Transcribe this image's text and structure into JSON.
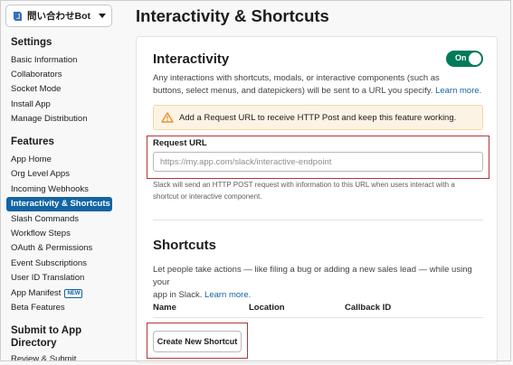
{
  "app": {
    "name": "問い合わせBot"
  },
  "sidebar": {
    "settings_heading": "Settings",
    "settings_items": [
      {
        "label": "Basic Information"
      },
      {
        "label": "Collaborators"
      },
      {
        "label": "Socket Mode"
      },
      {
        "label": "Install App"
      },
      {
        "label": "Manage Distribution"
      }
    ],
    "features_heading": "Features",
    "features_items": [
      {
        "label": "App Home"
      },
      {
        "label": "Org Level Apps"
      },
      {
        "label": "Incoming Webhooks"
      },
      {
        "label": "Interactivity & Shortcuts",
        "active": true
      },
      {
        "label": "Slash Commands"
      },
      {
        "label": "Workflow Steps"
      },
      {
        "label": "OAuth & Permissions"
      },
      {
        "label": "Event Subscriptions"
      },
      {
        "label": "User ID Translation"
      },
      {
        "label": "App Manifest",
        "badge": "NEW"
      },
      {
        "label": "Beta Features"
      }
    ],
    "submit_heading_line1": "Submit to App",
    "submit_heading_line2": "Directory",
    "submit_items": [
      {
        "label": "Review & Submit"
      }
    ]
  },
  "page": {
    "title": "Interactivity & Shortcuts"
  },
  "interactivity": {
    "title": "Interactivity",
    "toggle_label": "On",
    "toggle_state": "on",
    "description_line1": "Any interactions with shortcuts, modals, or interactive components (such as",
    "description_line2": "buttons, select menus, and datepickers) will be sent to a URL you specify.",
    "learn_more": "Learn more.",
    "warning": "Add a Request URL to receive HTTP Post and keep this feature working.",
    "request_url_label": "Request URL",
    "request_url_value": "",
    "request_url_placeholder": "https://my.app.com/slack/interactive-endpoint",
    "help_line1": "Slack will send an HTTP POST request with information to this URL when users interact with a",
    "help_line2": "shortcut or interactive component."
  },
  "shortcuts": {
    "title": "Shortcuts",
    "description_line1": "Let people take actions — like filing a bug or adding a new sales lead — while using your",
    "description_line2": "app in Slack.",
    "learn_more": "Learn more.",
    "columns": [
      "Name",
      "Location",
      "Callback ID"
    ],
    "create_button": "Create New Shortcut"
  },
  "colors": {
    "accent": "#1264a3",
    "toggle_on": "#007a5a",
    "highlight_box": "#b23636",
    "warning_bg": "#fdf3e4",
    "warning_icon": "#e8912d"
  },
  "icons": {
    "app": "app-logo-icon",
    "select_caret": "chevron-down-icon",
    "warning": "warning-triangle-icon"
  }
}
